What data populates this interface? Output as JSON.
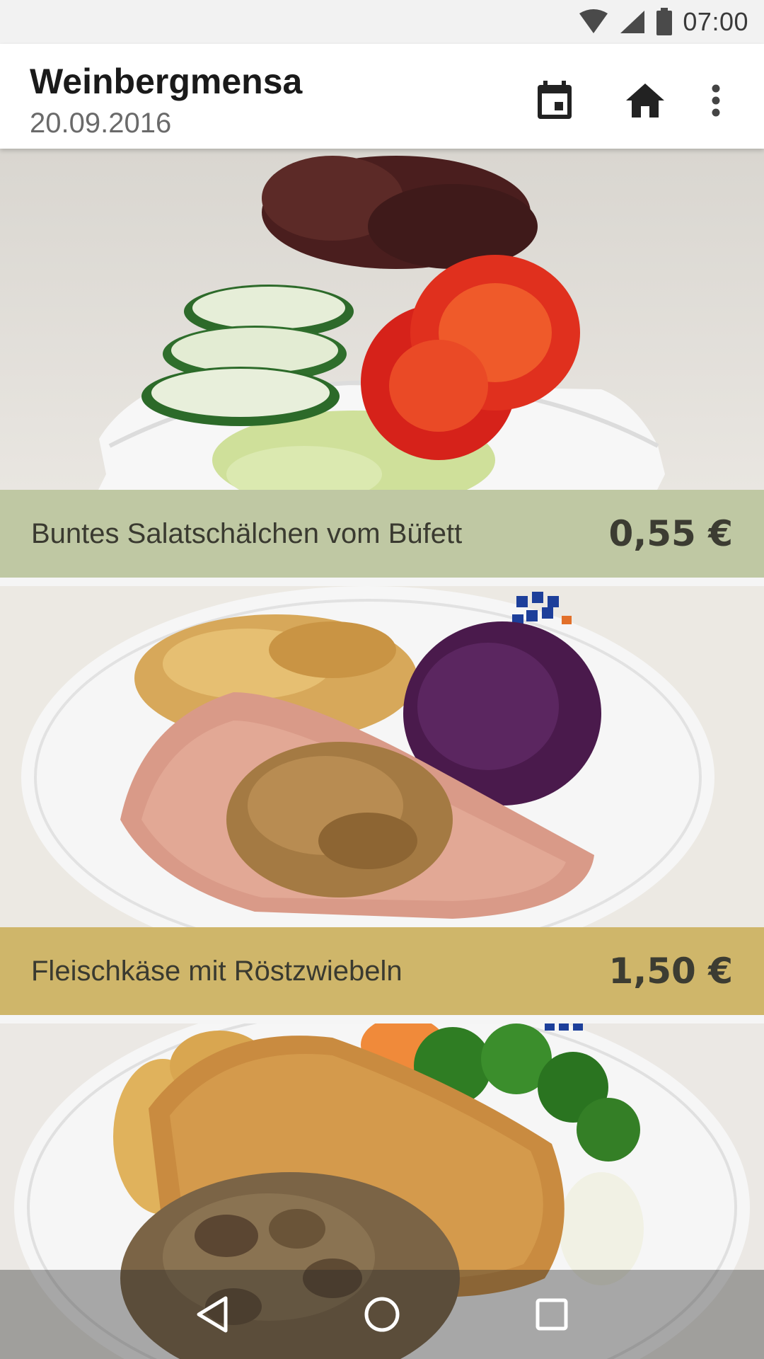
{
  "status_bar": {
    "time": "07:00",
    "icons": [
      "wifi-icon",
      "signal-icon",
      "battery-icon"
    ]
  },
  "app_bar": {
    "title": "Weinbergmensa",
    "date": "20.09.2016",
    "actions": [
      "calendar-icon",
      "home-icon",
      "more-vert-icon"
    ]
  },
  "meals": [
    {
      "name": "Buntes Salatschälchen vom Büfett",
      "price": "0,55 €",
      "bar_color": "#bfc8a3",
      "image": "salad"
    },
    {
      "name": "Fleischkäse mit Röstzwiebeln",
      "price": "1,50 €",
      "bar_color": "#cfb66a",
      "image": "meatloaf"
    },
    {
      "name": "",
      "price": "",
      "bar_color": "#ffffff",
      "image": "schnitzel"
    }
  ],
  "nav_bar": {
    "buttons": [
      "back-icon",
      "home-circle-icon",
      "recents-icon"
    ]
  }
}
